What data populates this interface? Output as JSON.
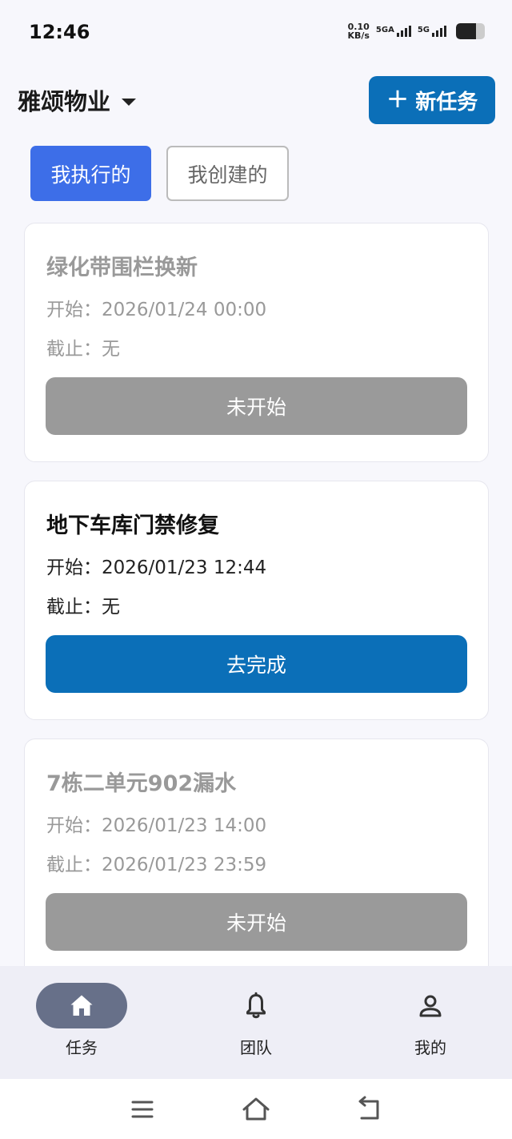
{
  "status_bar": {
    "time": "12:46",
    "net_speed_value": "0.10",
    "net_speed_unit": "KB/s",
    "sim1_label": "5GA",
    "sim2_label": "5G",
    "battery_level": 0.7
  },
  "header": {
    "org_name": "雅颂物业",
    "new_task_label": "新任务"
  },
  "tabs": [
    {
      "label": "我执行的",
      "active": true
    },
    {
      "label": "我创建的",
      "active": false
    }
  ],
  "tasks": [
    {
      "title": "绿化带围栏换新",
      "start_label": "开始：",
      "start": "2026/01/24 00:00",
      "deadline_label": "截止：",
      "deadline": "无",
      "action": "未开始"
    },
    {
      "title": "地下车库门禁修复",
      "start_label": "开始：",
      "start": "2026/01/23 12:44",
      "deadline_label": "截止：",
      "deadline": "无",
      "action": "去完成"
    },
    {
      "title": "7栋二单元902漏水",
      "start_label": "开始：",
      "start": "2026/01/23 14:00",
      "deadline_label": "截止：",
      "deadline": "2026/01/23 23:59",
      "action": "未开始"
    }
  ],
  "bottom_nav": [
    {
      "label": "任务",
      "icon": "home-icon",
      "active": true
    },
    {
      "label": "团队",
      "icon": "bell-icon",
      "active": false
    },
    {
      "label": "我的",
      "icon": "person-icon",
      "active": false
    }
  ],
  "colors": {
    "primary": "#0b6fb8",
    "tab_active": "#3d6ee8",
    "disabled": "#9a9a9a",
    "nav_active_pill": "#677089"
  }
}
